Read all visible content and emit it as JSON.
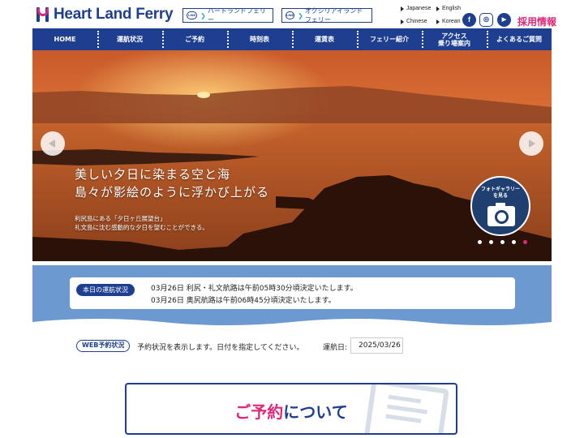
{
  "header": {
    "logo_text": "Heart Land Ferry",
    "line_buttons": [
      {
        "icon": "LINE",
        "label": "ハートランドフェリー"
      },
      {
        "icon": "LINE",
        "label": "オクシリアイランドフェリー"
      }
    ],
    "languages": [
      "Japanese",
      "English",
      "Chinese",
      "Korean"
    ],
    "social": [
      {
        "icon": "facebook-icon",
        "glyph": "f"
      },
      {
        "icon": "instagram-icon",
        "glyph": "◎"
      },
      {
        "icon": "youtube-icon",
        "glyph": "▶"
      }
    ],
    "recruit_label": "採用情報"
  },
  "nav": {
    "items": [
      "HOME",
      "運航状況",
      "ご予約",
      "時刻表",
      "運賃表",
      "フェリー紹介",
      "アクセス\n乗り場案内",
      "よくあるご質問"
    ]
  },
  "hero": {
    "caption_line1": "美しい夕日に染まる空と海",
    "caption_line2": "島々が影絵のように浮かび上がる",
    "sub_line1": "利尻島にある「夕日ヶ丘展望台」",
    "sub_line2": "礼文島に沈む感動的な夕日を望むことができる。",
    "gallery_label_line1": "フォトギャラリー",
    "gallery_label_line2": "を見る",
    "slide_count": 5,
    "active_slide": 5
  },
  "status": {
    "label": "本日の運航状況",
    "lines": [
      "03月26日 利尻・礼文航路は午前05時30分頃決定いたします。",
      "03月26日 奥尻航路は午前06時45分頃決定いたします。"
    ]
  },
  "web": {
    "label": "WEB予約状況",
    "text": "予約状況を表示します。日付を指定してください。",
    "date_label": "運航日:",
    "date_value": "2025/03/26"
  },
  "reserve": {
    "title_pink": "ご予約",
    "title_blue": "について"
  },
  "colors": {
    "brand_navy": "#1e3f8f",
    "brand_pink": "#e0287a",
    "status_band": "#6c9ad0"
  }
}
